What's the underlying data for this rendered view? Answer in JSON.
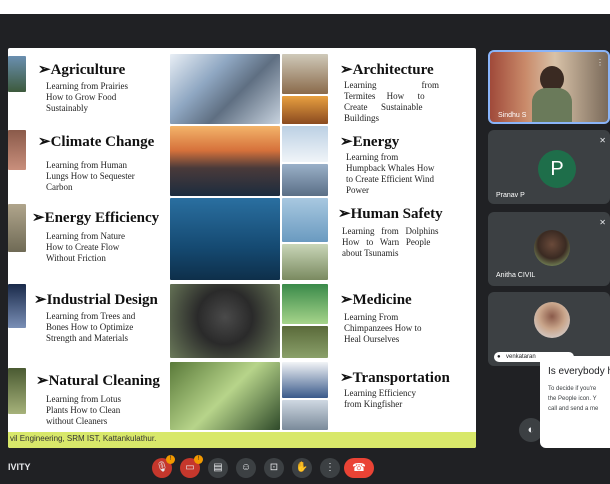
{
  "slide": {
    "sections": [
      {
        "heading": "➢Agriculture",
        "lines": [
          "Learning from Prairies",
          "How to Grow Food",
          "Sustainably"
        ]
      },
      {
        "heading": "➢Climate Change",
        "lines": [
          "Learning from Human",
          "Lungs How to Sequester",
          "Carbon"
        ]
      },
      {
        "heading": "➢Energy Efficiency",
        "lines": [
          "Learning from Nature",
          "How to Create Flow",
          "Without Friction"
        ]
      },
      {
        "heading": "➢Industrial Design",
        "lines": [
          "Learning from Trees and",
          "Bones How to Optimize",
          "Strength and Materials"
        ]
      },
      {
        "heading": "➢Natural Cleaning",
        "lines": [
          "Learning from Lotus",
          "Plants How to Clean",
          "without Cleaners"
        ]
      },
      {
        "heading": "➢Architecture",
        "lines": [
          "Learning                    from",
          "Termites     How      to",
          "Create      Sustainable",
          "Buildings"
        ]
      },
      {
        "heading": "➢Energy",
        "lines": [
          "Learning from",
          "Humpback Whales How",
          "to Create Efficient Wind",
          "Power"
        ]
      },
      {
        "heading": "➢Human Safety",
        "lines": [
          "Learning   from   Dolphins",
          "How   to   Warn   People",
          "about Tsunamis"
        ]
      },
      {
        "heading": "➢Medicine",
        "lines": [
          "Learning From",
          "Chimpanzees How to",
          "Heal Ourselves"
        ]
      },
      {
        "heading": "➢Transportation",
        "lines": [
          "Learning Efficiency",
          "from Kingfisher"
        ]
      }
    ],
    "footer": "vil Engineering, SRM IST, Kattankulathur."
  },
  "participants": [
    {
      "name": "Sindhu S"
    },
    {
      "name": "Pranav P",
      "initial": "P"
    },
    {
      "name": "Anitha CIVIL"
    },
    {
      "name": "venkataran"
    }
  ],
  "popup": {
    "title": "Is everybody h",
    "body": [
      "To decide if you're",
      "the People icon. Y",
      "call and send a me"
    ]
  },
  "meeting_label": "IVITY",
  "controls": {
    "mic_icon": "mic-off-icon",
    "cam_icon": "camera-off-icon",
    "captions_icon": "captions-icon",
    "emoji_icon": "emoji-icon",
    "present_icon": "present-icon",
    "hand_icon": "raise-hand-icon",
    "more_icon": "more-vert-icon",
    "end_icon": "end-call-icon",
    "end_color": "#ea4335",
    "badge_color": "#f29900"
  }
}
